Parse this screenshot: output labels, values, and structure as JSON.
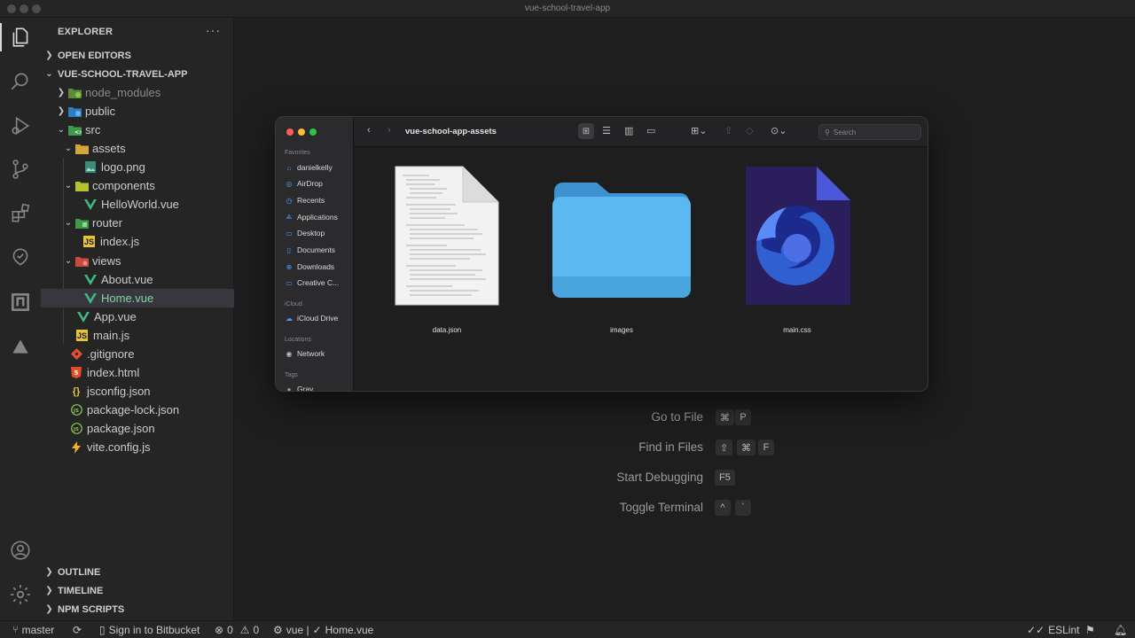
{
  "window": {
    "title": "vue-school-travel-app"
  },
  "sidebar": {
    "header": "EXPLORER",
    "more": "···",
    "open_editors": "OPEN EDITORS",
    "project": "VUE-SCHOOL-TRAVEL-APP",
    "tree": [
      {
        "label": "node_modules"
      },
      {
        "label": "public"
      },
      {
        "label": "src"
      },
      {
        "label": "assets"
      },
      {
        "label": "logo.png"
      },
      {
        "label": "components"
      },
      {
        "label": "HelloWorld.vue"
      },
      {
        "label": "router"
      },
      {
        "label": "index.js"
      },
      {
        "label": "views"
      },
      {
        "label": "About.vue"
      },
      {
        "label": "Home.vue"
      },
      {
        "label": "App.vue"
      },
      {
        "label": "main.js"
      },
      {
        "label": ".gitignore"
      },
      {
        "label": "index.html"
      },
      {
        "label": "jsconfig.json"
      },
      {
        "label": "package-lock.json"
      },
      {
        "label": "package.json"
      },
      {
        "label": "vite.config.js"
      }
    ],
    "outline": "OUTLINE",
    "timeline": "TIMELINE",
    "npm_scripts": "NPM SCRIPTS"
  },
  "welcome": {
    "shortcuts": [
      {
        "label": "Go to File",
        "keys": [
          "⌘",
          "P"
        ]
      },
      {
        "label": "Find in Files",
        "keys": [
          "⇧",
          "⌘",
          "F"
        ]
      },
      {
        "label": "Start Debugging",
        "keys": [
          "F5"
        ]
      },
      {
        "label": "Toggle Terminal",
        "keys": [
          "^",
          "`"
        ]
      }
    ]
  },
  "finder": {
    "title": "vue-school-app-assets",
    "search_placeholder": "Search",
    "favorites_caption": "Favorites",
    "favorites": [
      "danielkelly",
      "AirDrop",
      "Recents",
      "Applications",
      "Desktop",
      "Documents",
      "Downloads",
      "Creative C..."
    ],
    "icloud_caption": "iCloud",
    "icloud": [
      "iCloud Drive"
    ],
    "locations_caption": "Locations",
    "locations": [
      "Network"
    ],
    "tags_caption": "Tags",
    "tags": [
      "Gray"
    ],
    "files": [
      {
        "name": "data.json"
      },
      {
        "name": "images"
      },
      {
        "name": "main.css"
      }
    ]
  },
  "statusbar": {
    "branch": "master",
    "bitbucket": "Sign in to Bitbucket",
    "errors": "0",
    "warnings": "0",
    "vue": "vue |",
    "file": "Home.vue",
    "eslint": "ESLint"
  },
  "colors": {
    "vue_green": "#42b883",
    "selected_text": "#7fd6a4",
    "finder_folder": "#5cb8f0",
    "js_yellow": "#e8c33a"
  }
}
